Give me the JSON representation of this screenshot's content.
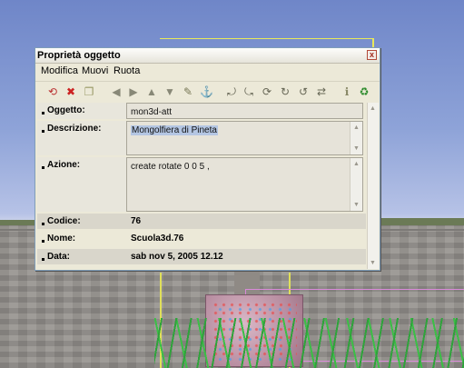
{
  "window": {
    "title": "Proprietà oggetto",
    "close_glyph": "x"
  },
  "menu": {
    "items": [
      "Modifica",
      "Muovi",
      "Ruota"
    ]
  },
  "toolbar": {
    "icons": [
      "undo-icon",
      "delete-icon",
      "copy-icon",
      "sep",
      "move-left-icon",
      "move-right-icon",
      "move-up-icon",
      "move-down-icon",
      "pin-icon",
      "anchor-icon",
      "sep",
      "rotate-x-icon",
      "rotate-y-icon",
      "rotate-z-icon",
      "rotate-xy-icon",
      "rotate-xz-icon",
      "rotate-yz-icon",
      "sep",
      "info-icon",
      "refresh-icon"
    ],
    "glyphs": [
      "⟲",
      "✖",
      "❐",
      "",
      "◀",
      "▶",
      "▲",
      "▼",
      "✎",
      "⚓",
      "",
      "⤾",
      "⤿",
      "⟳",
      "↻",
      "↺",
      "⇄",
      "",
      "ℹ",
      "♻"
    ]
  },
  "properties": {
    "oggetto": {
      "label": "Oggetto:",
      "value": "mon3d-att"
    },
    "descrizione": {
      "label": "Descrizione:",
      "value": "Mongolfiera di Pineta"
    },
    "azione": {
      "label": "Azione:",
      "value": "create rotate 0 0 5 ,"
    },
    "codice": {
      "label": "Codice:",
      "value": "76"
    },
    "nome": {
      "label": "Nome:",
      "value": "Scuola3d.76"
    },
    "data": {
      "label": "Data:",
      "value": "sab nov 5, 2005 12.12"
    }
  },
  "colors": {
    "selection": "#b4c6e3",
    "window_bg": "#ece9d8"
  }
}
